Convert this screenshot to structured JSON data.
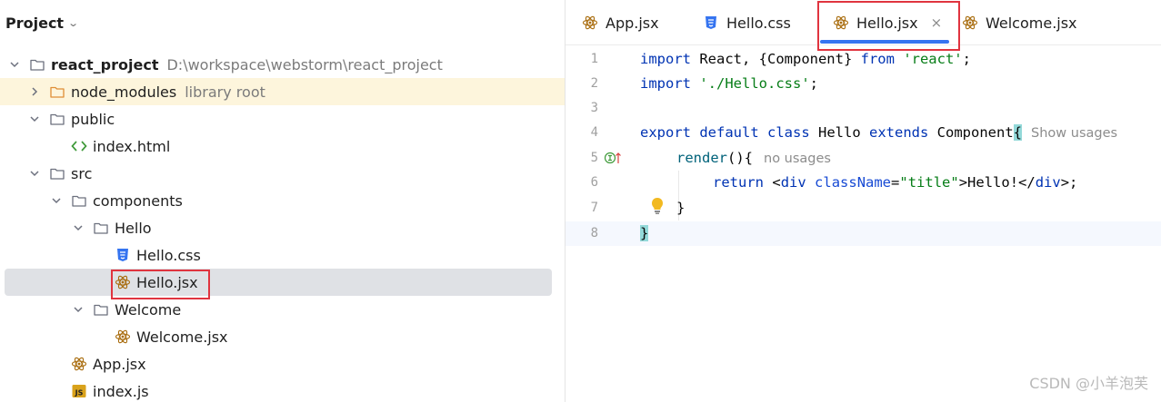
{
  "project_panel": {
    "title": "Project",
    "tree": [
      {
        "label": "react_project",
        "extra": "D:\\workspace\\webstorm\\react_project",
        "type": "folder",
        "expanded": true
      },
      {
        "label": "node_modules",
        "extra": "library root",
        "type": "folder-orange",
        "expanded": false
      },
      {
        "label": "public",
        "type": "folder",
        "expanded": true
      },
      {
        "label": "index.html",
        "type": "html"
      },
      {
        "label": "src",
        "type": "folder",
        "expanded": true
      },
      {
        "label": "components",
        "type": "folder",
        "expanded": true
      },
      {
        "label": "Hello",
        "type": "folder",
        "expanded": true
      },
      {
        "label": "Hello.css",
        "type": "css"
      },
      {
        "label": "Hello.jsx",
        "type": "react",
        "selected": true
      },
      {
        "label": "Welcome",
        "type": "folder",
        "expanded": true
      },
      {
        "label": "Welcome.jsx",
        "type": "react"
      },
      {
        "label": "App.jsx",
        "type": "react"
      },
      {
        "label": "index.js",
        "type": "js"
      }
    ]
  },
  "editor": {
    "tabs": [
      {
        "label": "App.jsx",
        "icon": "react-icon"
      },
      {
        "label": "Hello.css",
        "icon": "css-icon"
      },
      {
        "label": "Hello.jsx",
        "icon": "react-icon",
        "active": true,
        "close": "×"
      },
      {
        "label": "Welcome.jsx",
        "icon": "react-icon"
      }
    ],
    "line_numbers": [
      "1",
      "2",
      "3",
      "4",
      "5",
      "6",
      "7",
      "8"
    ],
    "code": {
      "l1_import": "import",
      "l1_mid": " React, {Component} ",
      "l1_from": "from",
      "l1_sp": " ",
      "l1_str": "'react'",
      "l1_end": ";",
      "l2_import": "import",
      "l2_sp": " ",
      "l2_str": "'./Hello.css'",
      "l2_end": ";",
      "l4_export": "export",
      "l4_sp1": " ",
      "l4_default": "default",
      "l4_sp2": " ",
      "l4_class": "class",
      "l4_name": " Hello ",
      "l4_extends": "extends",
      "l4_comp": " Component",
      "l4_brace": "{",
      "l4_hint": "Show usages",
      "l5_render": "render",
      "l5_rest": "(){",
      "l5_hint": "no usages",
      "l6_return": "return",
      "l6_sp": " ",
      "l6_lt": "<",
      "l6_div": "div",
      "l6_sp2": " ",
      "l6_attr": "className",
      "l6_eq": "=",
      "l6_val": "\"title\"",
      "l6_gt": ">Hello!</",
      "l6_div2": "div",
      "l6_end": ">;",
      "l7_brace": "}",
      "l8_brace": "}"
    }
  },
  "watermark": "CSDN @小羊泡芙"
}
